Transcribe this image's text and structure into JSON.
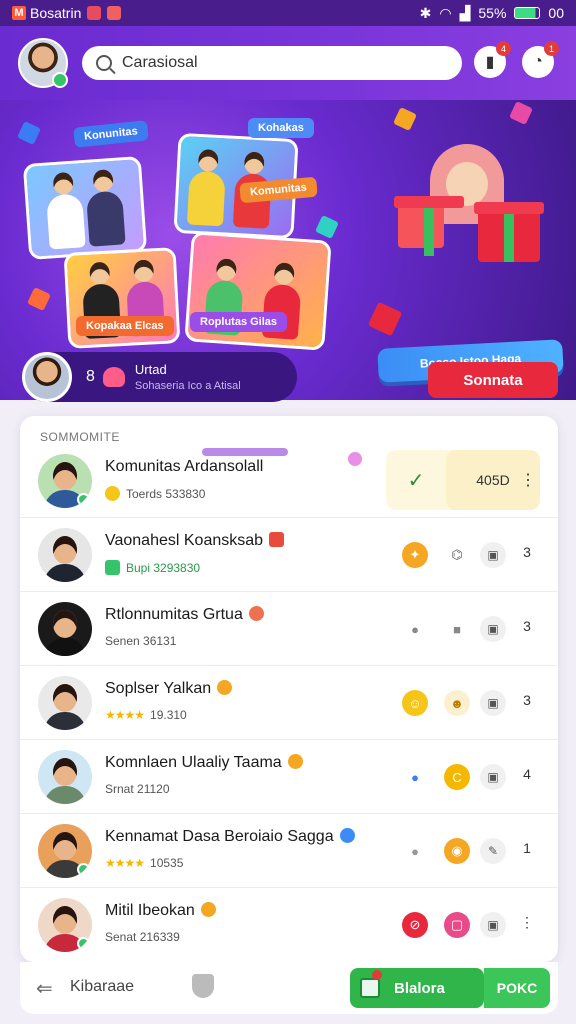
{
  "status_bar": {
    "app_name": "Bosatrin",
    "battery": "55%",
    "time": "00"
  },
  "header": {
    "search_placeholder": "Carasiosal",
    "search_value": "Carasiosal",
    "bookmark_badge": "4",
    "notif_badge": "1"
  },
  "hero": {
    "card_labels": [
      "Konunitas",
      "Kohakas",
      "Komunitas",
      "Kopakaa Elcas",
      "Roplutas Gilas"
    ],
    "gift_bar_text": "Boaso Istoo Haga",
    "live": {
      "count": "8",
      "title": "Urtad",
      "subtitle": "Sohaseria Ico a Atisal"
    },
    "cta_label": "Sonnata"
  },
  "panel": {
    "title": "SOMMOMITE",
    "featured_value": "405D",
    "rows": [
      {
        "name": "Komunitas Ardansolall",
        "sub": "Toerds 533830",
        "count": "⋮"
      },
      {
        "name": "Vaonahesl Koansksab",
        "sub": "Bupi 3293830",
        "count": "3"
      },
      {
        "name": "Rtlonnumitas Grtua",
        "sub": "Senen 36131",
        "count": "3"
      },
      {
        "name": "Soplser Yalkan",
        "sub": "19.310",
        "count": "3"
      },
      {
        "name": "Komnlaen Ulaaliy Taama",
        "sub": "Srnat 21120",
        "count": "4"
      },
      {
        "name": "Kennamat Dasa Beroiaio Sagga",
        "sub": "10535",
        "count": "1"
      },
      {
        "name": "Mitil Ibeokan",
        "sub": "Senat 216339",
        "count": "⋮"
      }
    ]
  },
  "bottom_bar": {
    "label": "Kibaraae",
    "primary_label": "Blalora",
    "secondary_label": "POKC"
  },
  "colors": {
    "accent": "#6a2bd0",
    "cta": "#e8283c",
    "green": "#2fb54a"
  }
}
